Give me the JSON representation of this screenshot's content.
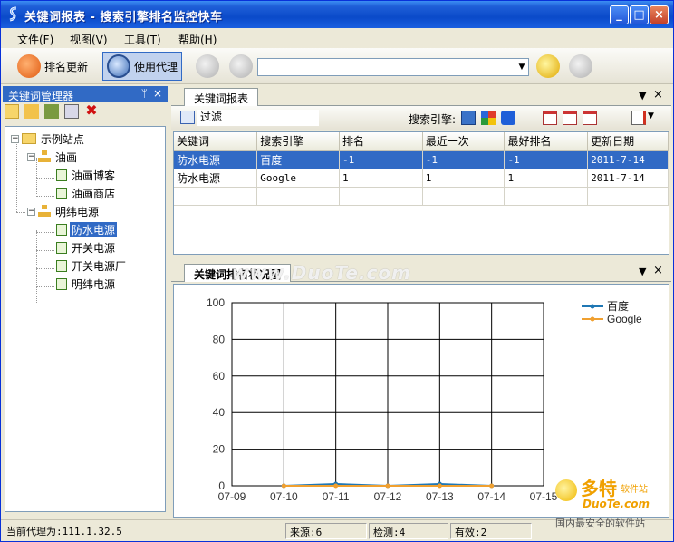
{
  "window": {
    "title": "关键词报表 - 搜索引擎排名监控快车",
    "btn_minimize": "_",
    "btn_maximize": "□",
    "btn_close": "×"
  },
  "menu": [
    "文件(F)",
    "视图(V)",
    "工具(T)",
    "帮助(H)"
  ],
  "toolbar": {
    "rank_update_label": "排名更新",
    "use_proxy_label": "使用代理",
    "address_value": ""
  },
  "left_pane": {
    "title": "关键词管理器",
    "pin": "ᛘ",
    "close": "×",
    "tree": [
      {
        "label": "示例站点",
        "level": 0,
        "type": "folder"
      },
      {
        "label": "油画",
        "level": 1,
        "type": "group"
      },
      {
        "label": "油画博客",
        "level": 2,
        "type": "page"
      },
      {
        "label": "油画商店",
        "level": 2,
        "type": "page"
      },
      {
        "label": "明纬电源",
        "level": 1,
        "type": "group"
      },
      {
        "label": "防水电源",
        "level": 2,
        "type": "page",
        "selected": true
      },
      {
        "label": "开关电源",
        "level": 2,
        "type": "page"
      },
      {
        "label": "开关电源厂",
        "level": 2,
        "type": "page"
      },
      {
        "label": "明纬电源",
        "level": 2,
        "type": "page"
      }
    ]
  },
  "report_panel": {
    "tab": "关键词报表",
    "filter_label": "过滤",
    "engine_label": "搜索引擎:",
    "columns": [
      "关键词",
      "搜索引擎",
      "排名",
      "最近一次",
      "最好排名",
      "更新日期"
    ],
    "rows": [
      [
        "防水电源",
        "百度",
        "-1",
        "-1",
        "-1",
        "2011-7-14"
      ],
      [
        "防水电源",
        "Google",
        "1",
        "1",
        "1",
        "2011-7-14"
      ]
    ]
  },
  "chart_panel": {
    "tab": "关键词排名状况图",
    "watermark": "www.DuoTe.com"
  },
  "chart_data": {
    "type": "line",
    "x": [
      "07-09",
      "07-10",
      "07-11",
      "07-12",
      "07-13",
      "07-14",
      "07-15"
    ],
    "ylim": [
      0,
      100
    ],
    "yticks": [
      0,
      20,
      40,
      60,
      80,
      100
    ],
    "grid": true,
    "legend_position": "top-right",
    "series": [
      {
        "name": "百度",
        "color": "#1f77b4",
        "x": [
          "07-10",
          "07-11",
          "07-12",
          "07-13",
          "07-14"
        ],
        "values": [
          0,
          1,
          0,
          1,
          0
        ]
      },
      {
        "name": "Google",
        "color": "#f0a030",
        "x": [
          "07-10",
          "07-11",
          "07-12",
          "07-13",
          "07-14"
        ],
        "values": [
          0,
          0,
          0,
          0,
          0
        ]
      }
    ]
  },
  "status": {
    "proxy": "当前代理为:111.1.32.5",
    "source": "来源:6",
    "check": "检测:4",
    "valid": "有效:2"
  },
  "brand": {
    "name_cn": "多特",
    "name_suffix": "软件站",
    "domain": "DuoTe.com",
    "slogan": "国内最安全的软件站"
  },
  "colors": {
    "titlebar": "#0a4ac9",
    "selection": "#316ac5",
    "baidu_series": "#1f77b4",
    "google_series": "#f0a030"
  }
}
